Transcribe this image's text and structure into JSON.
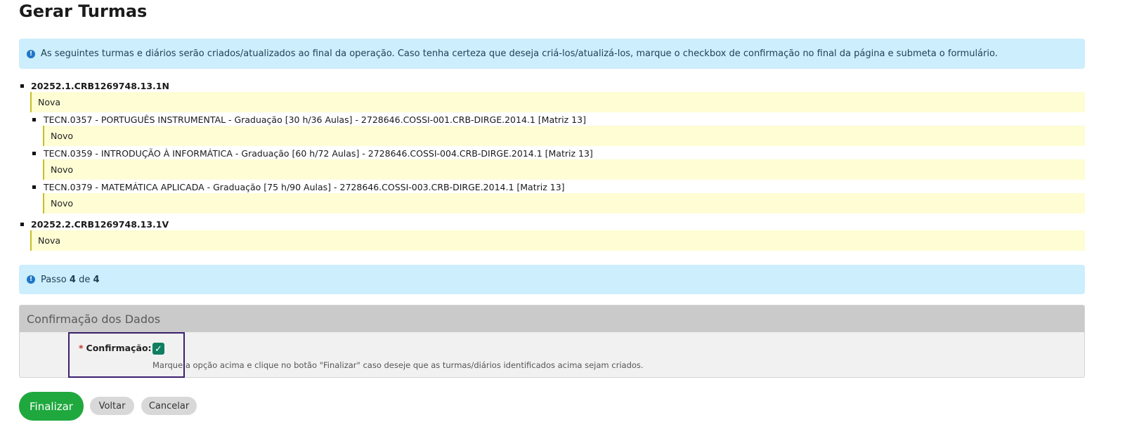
{
  "page_title": "Gerar Turmas",
  "info_message": "As seguintes turmas e diários serão criados/atualizados ao final da operação. Caso tenha certeza que deseja criá-los/atualizá-los, marque o checkbox de confirmação no final da página e submeta o formulário.",
  "turmas": [
    {
      "code": "20252.1.CRB1269748.13.1N",
      "status": "Nova",
      "diarios": [
        {
          "label": "TECN.0357 - PORTUGUÊS INSTRUMENTAL - Graduação [30 h/36 Aulas] - 2728646.COSSI-001.CRB-DIRGE.2014.1 [Matriz 13]",
          "status": "Novo"
        },
        {
          "label": "TECN.0359 - INTRODUÇÃO À INFORMÁTICA - Graduação [60 h/72 Aulas] - 2728646.COSSI-004.CRB-DIRGE.2014.1 [Matriz 13]",
          "status": "Novo"
        },
        {
          "label": "TECN.0379 - MATEMÁTICA APLICADA - Graduação [75 h/90 Aulas] - 2728646.COSSI-003.CRB-DIRGE.2014.1 [Matriz 13]",
          "status": "Novo"
        }
      ]
    },
    {
      "code": "20252.2.CRB1269748.13.1V",
      "status": "Nova",
      "diarios": []
    }
  ],
  "step": {
    "prefix": "Passo",
    "current": "4",
    "connector": "de",
    "total": "4"
  },
  "confirmation_panel": {
    "title": "Confirmação dos Dados",
    "required_mark": "*",
    "field_label": "Confirmação:",
    "checked": true,
    "help_text": "Marque a opção acima e clique no botão \"Finalizar\" caso deseje que as turmas/diários identificados acima sejam criados."
  },
  "buttons": {
    "finalize": "Finalizar",
    "back": "Voltar",
    "cancel": "Cancelar"
  },
  "icons": {
    "info": "info-icon",
    "checkbox_check": "check-icon"
  },
  "colors": {
    "info_bg": "#cdeefc",
    "note_bg": "#fefdd4",
    "primary_button": "#1fa83e",
    "checkbox": "#0f7f61"
  }
}
